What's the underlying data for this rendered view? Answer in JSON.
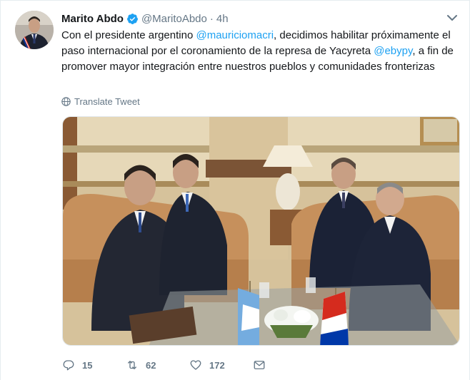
{
  "author": {
    "name": "Marito Abdo",
    "handle": "@MaritoAbdo",
    "separator": "·",
    "time": "4h",
    "verified": true
  },
  "tweet": {
    "parts": [
      {
        "type": "text",
        "value": "Con el presidente argentino "
      },
      {
        "type": "mention",
        "value": "@mauriciomacri"
      },
      {
        "type": "text",
        "value": ", decidimos habilitar próximamente el paso internacional por el coronamiento de la represa de Yacyreta "
      },
      {
        "type": "mention",
        "value": "@ebypy"
      },
      {
        "type": "text",
        "value": ", a fin de promover mayor integración entre nuestros pueblos y comunidades fronterizas"
      }
    ],
    "translate_label": "Translate Tweet"
  },
  "actions": {
    "replies": "15",
    "retweets": "62",
    "likes": "172"
  },
  "colors": {
    "accent": "#1da1f2",
    "muted": "#657786",
    "text": "#14171a"
  },
  "icons": [
    "verified-badge-icon",
    "chevron-down-icon",
    "globe-icon",
    "reply-icon",
    "retweet-icon",
    "like-icon",
    "direct-message-icon"
  ]
}
